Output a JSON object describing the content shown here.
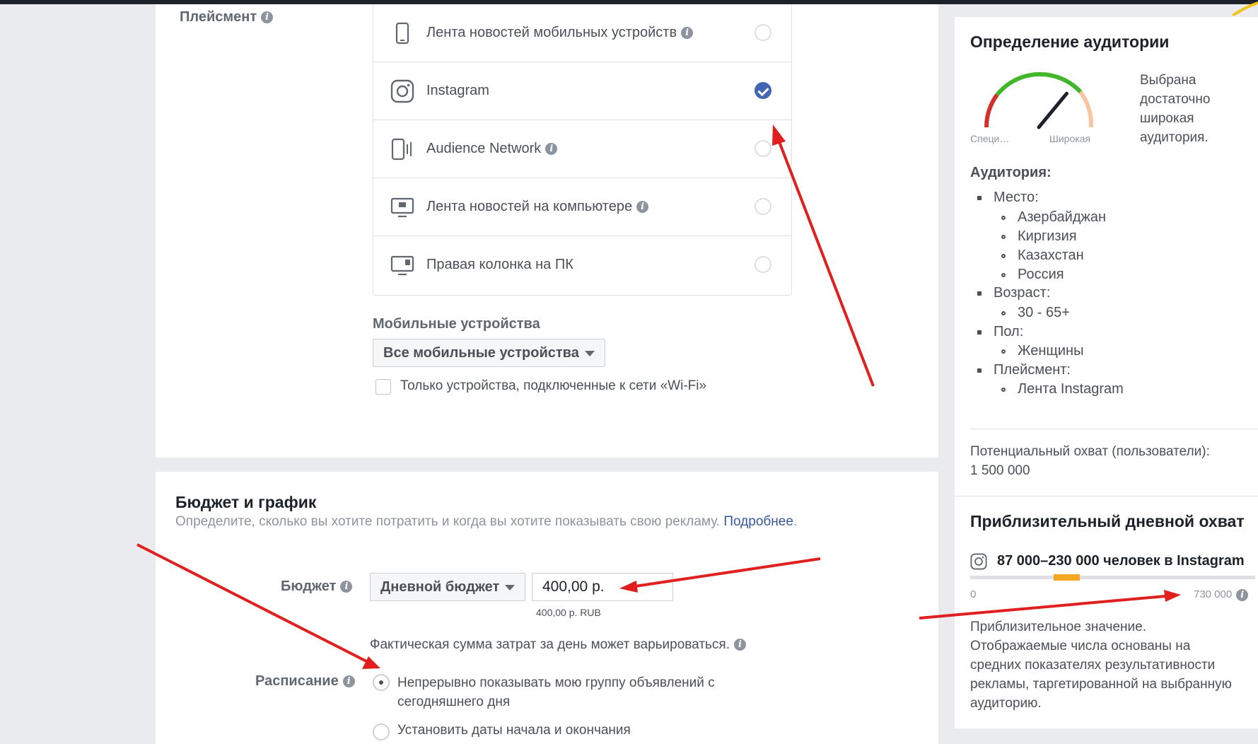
{
  "placement": {
    "label": "Плейсмент",
    "items": [
      {
        "label": "Лента новостей мобильных устройств",
        "info": true,
        "selected": false,
        "icon": "mobile-phone-icon"
      },
      {
        "label": "Instagram",
        "info": false,
        "selected": true,
        "icon": "instagram-icon"
      },
      {
        "label": "Audience Network",
        "info": true,
        "selected": false,
        "icon": "audience-network-icon"
      },
      {
        "label": "Лента новостей на компьютере",
        "info": true,
        "selected": false,
        "icon": "desktop-icon"
      },
      {
        "label": "Правая колонка на ПК",
        "info": false,
        "selected": false,
        "icon": "desktop-right-column-icon"
      }
    ],
    "mobile_devices_label": "Мобильные устройства",
    "mobile_devices_value": "Все мобильные устройства",
    "wifi_only_label": "Только устройства, подключенные к сети «Wi-Fi»"
  },
  "budget": {
    "title": "Бюджет и график",
    "description": "Определите, сколько вы хотите потратить и когда вы хотите показывать свою рекламу.",
    "more_link": "Подробнее",
    "budget_label": "Бюджет",
    "budget_type": "Дневной бюджет",
    "amount": "400,00 р.",
    "amount_hint": "400,00 р. RUB",
    "note": "Фактическая сумма затрат за день может варьироваться.",
    "schedule_label": "Расписание",
    "schedule_option1_line1": "Непрерывно показывать мою группу объявлений с",
    "schedule_option1_line2": "сегодняшнего дня",
    "schedule_option2": "Установить даты начала и окончания"
  },
  "audience": {
    "title": "Определение аудитории",
    "gauge_left": "Специ…",
    "gauge_right": "Широкая",
    "gauge_level": 0.72,
    "summary_lines": [
      "Выбрана",
      "достаточно",
      "широкая",
      "аудитория."
    ],
    "audience_label": "Аудитория:",
    "location_label": "Место:",
    "locations": [
      "Азербайджан",
      "Киргизия",
      "Казахстан",
      "Россия"
    ],
    "age_label": "Возраст:",
    "age": "30 - 65+",
    "gender_label": "Пол:",
    "gender": "Женщины",
    "placement_label": "Плейсмент:",
    "placement": "Лента Instagram",
    "reach_label": "Потенциальный охват (пользователи):",
    "reach_value": "1 500 000"
  },
  "daily_reach": {
    "title": "Приблизительный дневной охват",
    "range": "87 000–230 000 человек в Instagram",
    "scale_min": "0",
    "scale_max": "730 000",
    "note_lines": [
      "Приблизительное значение.",
      "Отображаемые числа основаны на",
      "средних показателях результативности",
      "рекламы, таргетированной на выбранную",
      "аудиторию."
    ]
  },
  "colors": {
    "accent": "#4267b2",
    "annotation_arrow": "#e01f1f",
    "reach_bar": "#f5a623",
    "gauge_green": "#42b72a",
    "gauge_red": "#d0312d",
    "gauge_peach": "#f7c59f"
  }
}
